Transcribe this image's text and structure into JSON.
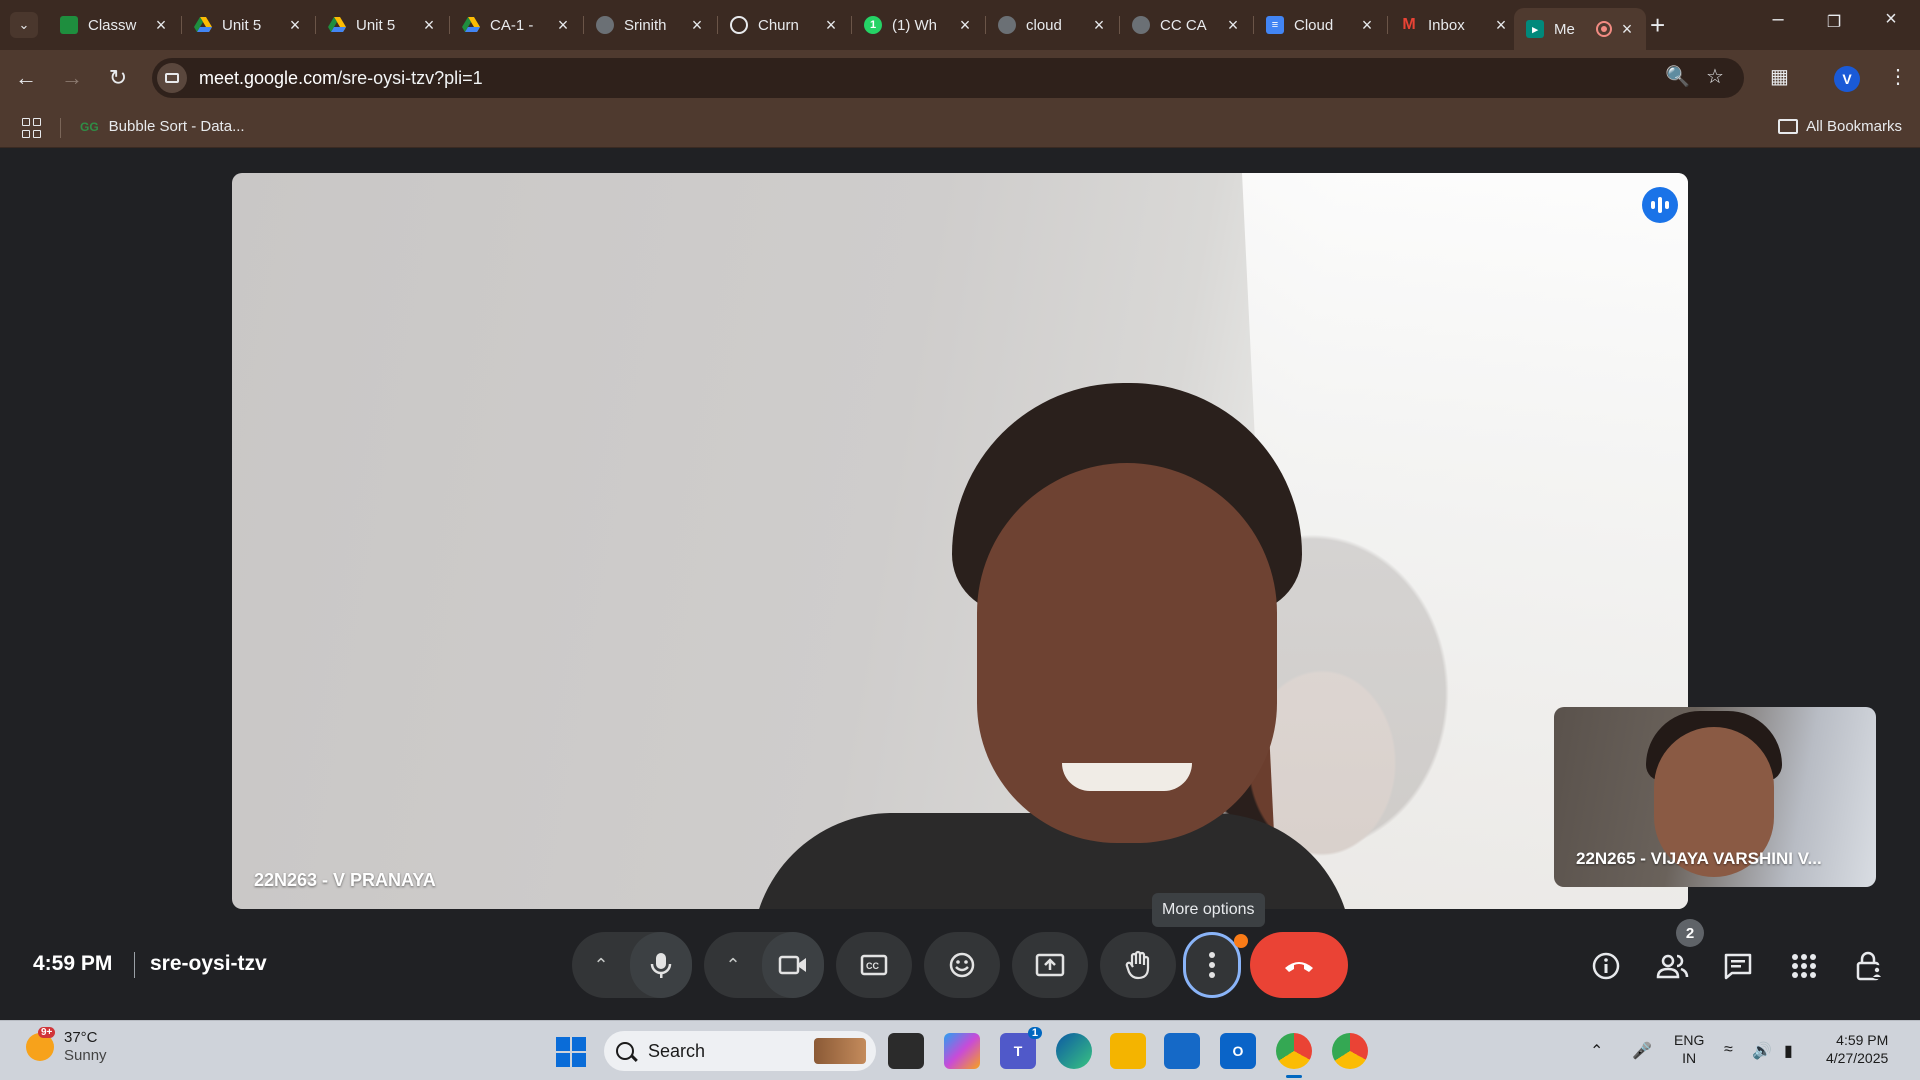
{
  "browser": {
    "tabs": [
      {
        "title": "Classw",
        "icon": "google-classroom-icon",
        "color": "#1e8e3e"
      },
      {
        "title": "Unit 5",
        "icon": "google-drive-icon",
        "color": "#fbbc04"
      },
      {
        "title": "Unit 5",
        "icon": "google-drive-icon",
        "color": "#fbbc04"
      },
      {
        "title": "CA-1 -",
        "icon": "google-drive-icon",
        "color": "#fbbc04"
      },
      {
        "title": "Srinith",
        "icon": "globe-icon",
        "color": "#9aa0a6"
      },
      {
        "title": "Churn",
        "icon": "chatgpt-icon",
        "color": "#e8eaed"
      },
      {
        "title": "(1) Wh",
        "icon": "whatsapp-icon",
        "color": "#25d366"
      },
      {
        "title": "cloud",
        "icon": "globe-icon",
        "color": "#9aa0a6"
      },
      {
        "title": "CC CA",
        "icon": "globe-icon",
        "color": "#9aa0a6"
      },
      {
        "title": "Cloud",
        "icon": "google-docs-icon",
        "color": "#4285f4"
      },
      {
        "title": "Inbox",
        "icon": "gmail-icon",
        "color": "#ea4335"
      },
      {
        "title": "Me",
        "icon": "google-meet-icon",
        "color": "#00897b",
        "active": true
      }
    ],
    "url_host": "meet.google.com",
    "url_path": "/sre-oysi-tzv?pli=1",
    "profile_initial": "V",
    "bookmark": "Bubble Sort - Data...",
    "all_bookmarks": "All Bookmarks"
  },
  "meet": {
    "main_participant": "22N263 - V PRANAYA",
    "self_participant": "22N265 - VIJAYA VARSHINI V...",
    "tooltip": "More options",
    "time": "4:59 PM",
    "meeting_code": "sre-oysi-tzv",
    "participant_count": "2",
    "end_call_color": "#ea4335",
    "accent_color": "#8ab4f8"
  },
  "taskbar": {
    "temperature": "37°C",
    "condition": "Sunny",
    "weather_badge": "9+",
    "search_placeholder": "Search",
    "teams_badge": "1",
    "lang_line1": "ENG",
    "lang_line2": "IN",
    "clock_time": "4:59 PM",
    "clock_date": "4/27/2025"
  }
}
